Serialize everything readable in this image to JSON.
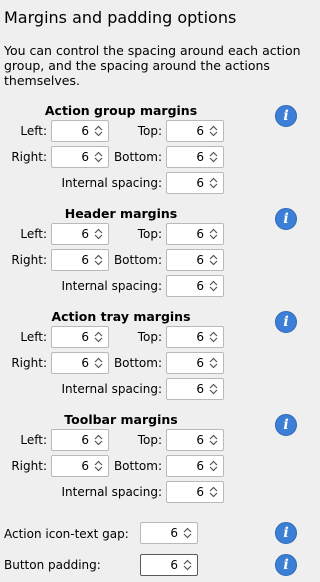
{
  "title": "Margins and padding options",
  "description": "You can control the spacing around each action group, and the spacing around the actions themselves.",
  "sections": [
    {
      "heading": "Action group margins",
      "left_label": "Left:",
      "left": "6",
      "top_label": "Top:",
      "top": "6",
      "right_label": "Right:",
      "right": "6",
      "bottom_label": "Bottom:",
      "bottom": "6",
      "internal_label": "Internal spacing:",
      "internal": "6"
    },
    {
      "heading": "Header margins",
      "left_label": "Left:",
      "left": "6",
      "top_label": "Top:",
      "top": "6",
      "right_label": "Right:",
      "right": "6",
      "bottom_label": "Bottom:",
      "bottom": "6",
      "internal_label": "Internal spacing:",
      "internal": "6"
    },
    {
      "heading": "Action tray margins",
      "left_label": "Left:",
      "left": "6",
      "top_label": "Top:",
      "top": "6",
      "right_label": "Right:",
      "right": "6",
      "bottom_label": "Bottom:",
      "bottom": "6",
      "internal_label": "Internal spacing:",
      "internal": "6"
    },
    {
      "heading": "Toolbar margins",
      "left_label": "Left:",
      "left": "6",
      "top_label": "Top:",
      "top": "6",
      "right_label": "Right:",
      "right": "6",
      "bottom_label": "Bottom:",
      "bottom": "6",
      "internal_label": "Internal spacing:",
      "internal": "6"
    }
  ],
  "icon_text_gap": {
    "label": "Action icon-text gap:",
    "value": "6"
  },
  "button_padding": {
    "label": "Button padding:",
    "value": "6"
  },
  "icons": {
    "info": "info-icon",
    "spinner": "up-down-chevron-icon"
  },
  "colors": {
    "info": "#3d7fd6",
    "background": "#efefef"
  }
}
